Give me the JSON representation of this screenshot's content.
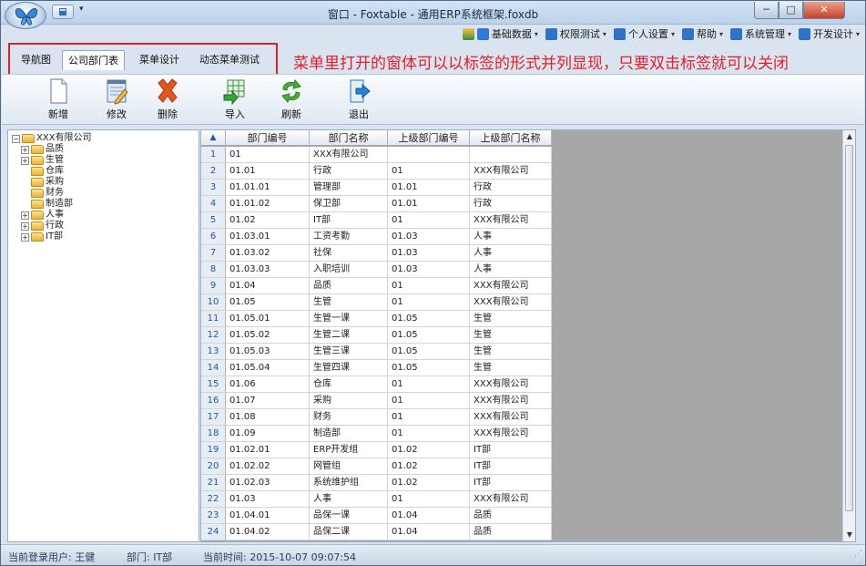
{
  "window": {
    "title": "窗口 - Foxtable - 通用ERP系统框架.foxdb",
    "minimize": "─",
    "maximize": "□",
    "close": "✕"
  },
  "menu": [
    {
      "label": "基础数据",
      "icon_color": "#2e7ad6"
    },
    {
      "label": "权限测试",
      "icon_color": "#2f73c7"
    },
    {
      "label": "个人设置",
      "icon_color": "#2f73c7"
    },
    {
      "label": "帮助",
      "icon_color": "#2f73c7"
    },
    {
      "label": "系统管理",
      "icon_color": "#2f73c7"
    },
    {
      "label": "开发设计",
      "icon_color": "#2f73c7"
    }
  ],
  "tabs": [
    "导航图",
    "公司部门表",
    "菜单设计",
    "动态菜单测试"
  ],
  "active_tab": "公司部门表",
  "annotation": "菜单里打开的窗体可以以标签的形式并列显现，只要双击标签就可以关闭",
  "ribbon": [
    {
      "label": "新增",
      "icon": "new-doc-icon"
    },
    {
      "label": "修改",
      "icon": "edit-doc-icon"
    },
    {
      "label": "删除",
      "icon": "delete-x-icon"
    },
    {
      "label": "导入",
      "icon": "import-icon"
    },
    {
      "label": "刷新",
      "icon": "refresh-icon"
    },
    {
      "label": "退出",
      "icon": "exit-icon"
    }
  ],
  "tree": [
    {
      "label": "XXX有限公司",
      "level": 0,
      "expander": "⊟"
    },
    {
      "label": "品质",
      "level": 1,
      "expander": "+"
    },
    {
      "label": "生管",
      "level": 1,
      "expander": "+"
    },
    {
      "label": "仓库",
      "level": 1,
      "expander": ""
    },
    {
      "label": "采购",
      "level": 1,
      "expander": ""
    },
    {
      "label": "财务",
      "level": 1,
      "expander": ""
    },
    {
      "label": "制造部",
      "level": 1,
      "expander": ""
    },
    {
      "label": "人事",
      "level": 1,
      "expander": "+"
    },
    {
      "label": "行政",
      "level": 1,
      "expander": "+"
    },
    {
      "label": "IT部",
      "level": 1,
      "expander": "+"
    }
  ],
  "grid": {
    "corner": "▲",
    "headers": [
      "部门编号",
      "部门名称",
      "上级部门编号",
      "上级部门名称"
    ],
    "rows": [
      [
        "1",
        "01",
        "XXX有限公司",
        "",
        ""
      ],
      [
        "2",
        "01.01",
        "行政",
        "01",
        "XXX有限公司"
      ],
      [
        "3",
        "01.01.01",
        "管理部",
        "01.01",
        "行政"
      ],
      [
        "4",
        "01.01.02",
        "保卫部",
        "01.01",
        "行政"
      ],
      [
        "5",
        "01.02",
        "IT部",
        "01",
        "XXX有限公司"
      ],
      [
        "6",
        "01.03.01",
        "工资考勤",
        "01.03",
        "人事"
      ],
      [
        "7",
        "01.03.02",
        "社保",
        "01.03",
        "人事"
      ],
      [
        "8",
        "01.03.03",
        "入职培训",
        "01.03",
        "人事"
      ],
      [
        "9",
        "01.04",
        "品质",
        "01",
        "XXX有限公司"
      ],
      [
        "10",
        "01.05",
        "生管",
        "01",
        "XXX有限公司"
      ],
      [
        "11",
        "01.05.01",
        "生管一课",
        "01.05",
        "生管"
      ],
      [
        "12",
        "01.05.02",
        "生管二课",
        "01.05",
        "生管"
      ],
      [
        "13",
        "01.05.03",
        "生管三课",
        "01.05",
        "生管"
      ],
      [
        "14",
        "01.05.04",
        "生管四课",
        "01.05",
        "生管"
      ],
      [
        "15",
        "01.06",
        "仓库",
        "01",
        "XXX有限公司"
      ],
      [
        "16",
        "01.07",
        "采购",
        "01",
        "XXX有限公司"
      ],
      [
        "17",
        "01.08",
        "财务",
        "01",
        "XXX有限公司"
      ],
      [
        "18",
        "01.09",
        "制造部",
        "01",
        "XXX有限公司"
      ],
      [
        "19",
        "01.02.01",
        "ERP开发组",
        "01.02",
        "IT部"
      ],
      [
        "20",
        "01.02.02",
        "网管组",
        "01.02",
        "IT部"
      ],
      [
        "21",
        "01.02.03",
        "系统维护组",
        "01.02",
        "IT部"
      ],
      [
        "22",
        "01.03",
        "人事",
        "01",
        "XXX有限公司"
      ],
      [
        "23",
        "01.04.01",
        "品保一课",
        "01.04",
        "品质"
      ],
      [
        "24",
        "01.04.02",
        "品保二课",
        "01.04",
        "品质"
      ]
    ]
  },
  "status": {
    "user": "当前登录用户: 王健",
    "dept": "部门: IT部",
    "time": "当前时间: 2015-10-07 09:07:54"
  }
}
